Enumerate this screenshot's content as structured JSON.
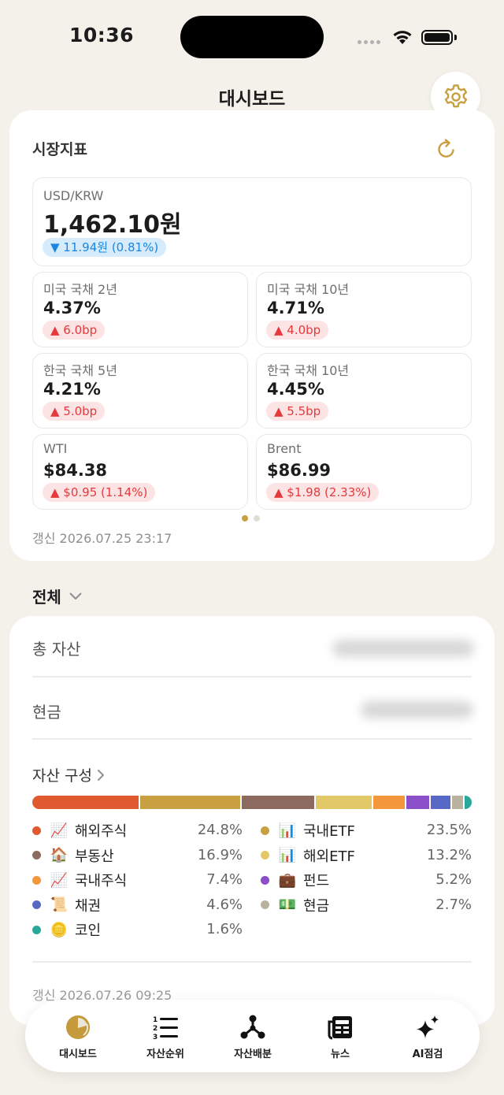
{
  "status": {
    "time": "10:36"
  },
  "nav": {
    "title": "대시보드"
  },
  "market": {
    "title": "시장지표",
    "fx": {
      "label": "USD/KRW",
      "value": "1,462.10원",
      "change": "▼ 11.94원 (0.81%)",
      "direction": "down"
    },
    "tiles": [
      {
        "label": "미국 국채 2년",
        "value": "4.37%",
        "change": "▲ 6.0bp",
        "direction": "up"
      },
      {
        "label": "미국 국채 10년",
        "value": "4.71%",
        "change": "▲ 4.0bp",
        "direction": "up"
      },
      {
        "label": "한국 국채 5년",
        "value": "4.21%",
        "change": "▲ 5.0bp",
        "direction": "up"
      },
      {
        "label": "한국 국채 10년",
        "value": "4.45%",
        "change": "▲ 5.5bp",
        "direction": "up"
      },
      {
        "label": "WTI",
        "value": "$84.38",
        "change": "▲ $0.95 (1.14%)",
        "direction": "up"
      },
      {
        "label": "Brent",
        "value": "$86.99",
        "change": "▲ $1.98 (2.33%)",
        "direction": "up"
      }
    ],
    "page_count": 2,
    "active_page": 1,
    "updated": "갱신 2026.07.25 23:17"
  },
  "filter": {
    "label": "전체"
  },
  "assets": {
    "total_label": "총 자산",
    "cash_label": "현금",
    "composition_title": "자산 구성",
    "categories": [
      {
        "name": "해외주식",
        "pct": "24.8%",
        "value": 24.8,
        "color": "#df5a2e",
        "emoji": "📈"
      },
      {
        "name": "국내ETF",
        "pct": "23.5%",
        "value": 23.5,
        "color": "#c9a041",
        "emoji": "📊"
      },
      {
        "name": "부동산",
        "pct": "16.9%",
        "value": 16.9,
        "color": "#8c6a5f",
        "emoji": "🏠"
      },
      {
        "name": "해외ETF",
        "pct": "13.2%",
        "value": 13.2,
        "color": "#e2c866",
        "emoji": "📊"
      },
      {
        "name": "국내주식",
        "pct": "7.4%",
        "value": 7.4,
        "color": "#f3963c",
        "emoji": "📈"
      },
      {
        "name": "펀드",
        "pct": "5.2%",
        "value": 5.2,
        "color": "#8a4fc9",
        "emoji": "💼"
      },
      {
        "name": "채권",
        "pct": "4.6%",
        "value": 4.6,
        "color": "#5769c4",
        "emoji": "📜"
      },
      {
        "name": "현금",
        "pct": "2.7%",
        "value": 2.7,
        "color": "#b8b29f",
        "emoji": "💵"
      },
      {
        "name": "코인",
        "pct": "1.6%",
        "value": 1.6,
        "color": "#2aa79b",
        "emoji": "🪙"
      }
    ],
    "updated": "갱신 2026.07.26 09:25"
  },
  "tabs": [
    {
      "label": "대시보드",
      "icon": "pie-chart-icon",
      "active": true
    },
    {
      "label": "자산순위",
      "icon": "ranked-list-icon",
      "active": false
    },
    {
      "label": "자산배분",
      "icon": "network-icon",
      "active": false
    },
    {
      "label": "뉴스",
      "icon": "newspaper-icon",
      "active": false
    },
    {
      "label": "AI점검",
      "icon": "sparkles-icon",
      "active": false
    }
  ],
  "colors": {
    "accent": "#b08a35",
    "up": "#e5393c",
    "down": "#1a86e0",
    "background": "#f4f1ea"
  }
}
